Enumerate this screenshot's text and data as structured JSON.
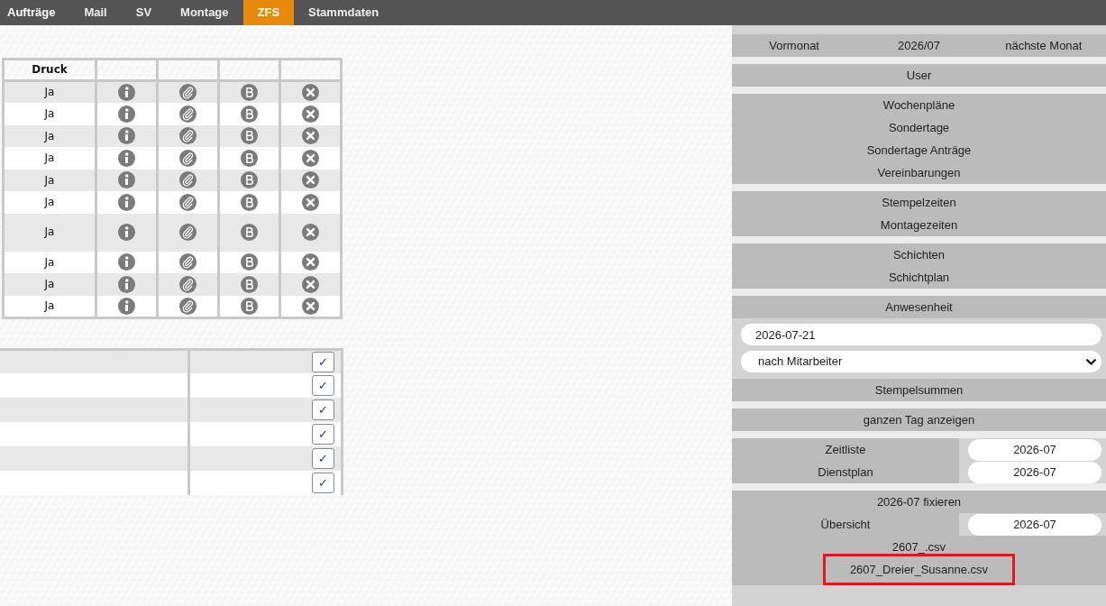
{
  "nav": {
    "items": [
      {
        "label": "Aufträge",
        "selected": false
      },
      {
        "label": "Mail",
        "selected": false
      },
      {
        "label": "SV",
        "selected": false
      },
      {
        "label": "Montage",
        "selected": false
      },
      {
        "label": "ZFS",
        "selected": true
      },
      {
        "label": "Stammdaten",
        "selected": false
      }
    ]
  },
  "print_table": {
    "header": "Druck",
    "rows": [
      {
        "druck": "Ja"
      },
      {
        "druck": "Ja"
      },
      {
        "druck": "Ja"
      },
      {
        "druck": "Ja"
      },
      {
        "druck": "Ja"
      },
      {
        "druck": "Ja"
      },
      {
        "druck": "Ja"
      },
      {
        "druck": "Ja"
      },
      {
        "druck": "Ja"
      },
      {
        "druck": "Ja"
      }
    ]
  },
  "confirm_table": {
    "rows": [
      {
        "button": "✓"
      },
      {
        "button": "✓"
      },
      {
        "button": "✓"
      },
      {
        "button": "✓"
      },
      {
        "button": "✓"
      },
      {
        "button": "✓"
      }
    ]
  },
  "side_panel": {
    "month_nav": {
      "prev": "Vormonat",
      "current": "2026/07",
      "next": "nächste Monat"
    },
    "link_groups": [
      [
        "User"
      ],
      [
        "Wochenpläne",
        "Sondertage",
        "Sondertage Anträge",
        "Vereinbarungen"
      ],
      [
        "Stempelzeiten",
        "Montagezeiten"
      ],
      [
        "Schichten",
        "Schichtplan"
      ]
    ],
    "attendance": {
      "title": "Anwesenheit",
      "date": "2026-07-21",
      "mode": "nach Mitarbeiter",
      "button": "Stempelsummen"
    },
    "day_button": "ganzen Tag anzeigen",
    "exports": [
      {
        "label": "Zeitliste",
        "month": "2026-07"
      },
      {
        "label": "Dienstplan",
        "month": "2026-07"
      }
    ],
    "fix": {
      "title": "2026-07 fixieren",
      "rows": [
        {
          "label": "Übersicht",
          "month": "2026-07"
        }
      ],
      "files": [
        {
          "name": "2607_.csv",
          "highlighted": false
        },
        {
          "name": "2607_Dreier_Susanne.csv",
          "highlighted": true
        }
      ]
    }
  }
}
